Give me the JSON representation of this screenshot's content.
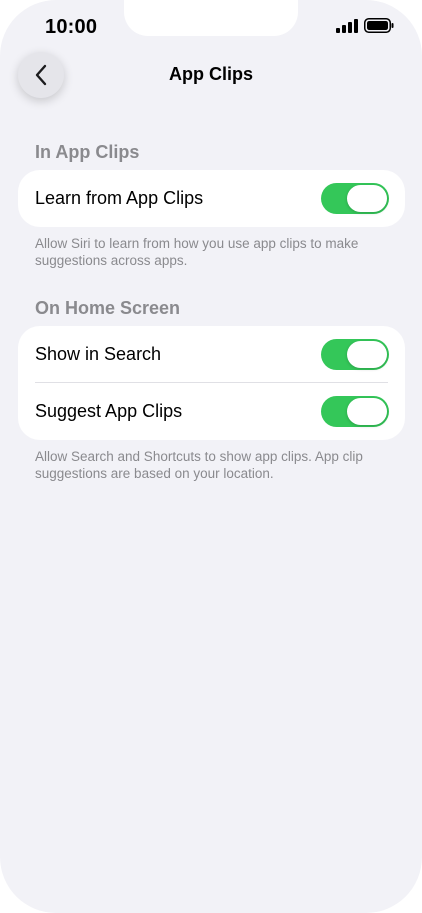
{
  "status_bar": {
    "time": "10:00",
    "signal_icon": "cellular-signal-icon",
    "battery_icon": "battery-icon"
  },
  "nav": {
    "back_icon": "chevron-left-icon",
    "title": "App Clips"
  },
  "sections": [
    {
      "header": "In App Clips",
      "rows": [
        {
          "label": "Learn from App Clips",
          "toggle_on": true
        }
      ],
      "footer": "Allow Siri to learn from how you use app clips to make suggestions across apps."
    },
    {
      "header": "On Home Screen",
      "rows": [
        {
          "label": "Show in Search",
          "toggle_on": true
        },
        {
          "label": "Suggest App Clips",
          "toggle_on": true
        }
      ],
      "footer": "Allow Search and Shortcuts to show app clips. App clip suggestions are based on your location."
    }
  ],
  "colors": {
    "toggle_on": "#34c759",
    "background": "#f2f2f7"
  }
}
